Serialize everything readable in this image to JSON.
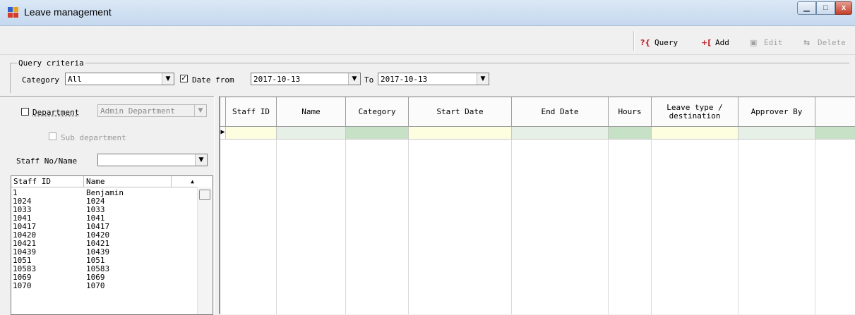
{
  "window": {
    "title": "Leave management",
    "min": "▁",
    "max": "□",
    "close": "x"
  },
  "toolbar": {
    "query": {
      "icon": "?{",
      "label": "Query"
    },
    "add": {
      "icon": "+[",
      "label": "Add"
    },
    "edit": {
      "icon": "▣",
      "label": "Edit"
    },
    "delete": {
      "icon": "⇆",
      "label": "Delete"
    }
  },
  "query": {
    "group_title": "Query criteria",
    "category_label": "Category",
    "category_value": "All",
    "date_from_label": "Date from",
    "date_from_checked": "✓",
    "date_from_value": "2017-10-13",
    "to_label": "To",
    "to_value": "2017-10-13"
  },
  "left": {
    "department_label": "Department",
    "department_value": "Admin Department",
    "sub_department_label": "Sub department",
    "staff_label": "Staff No/Name",
    "staff_value": "",
    "list_headers": [
      "Staff ID",
      "Name"
    ],
    "list_rows": [
      [
        "1",
        "Benjamin"
      ],
      [
        "1024",
        "1024"
      ],
      [
        "1033",
        "1033"
      ],
      [
        "1041",
        "1041"
      ],
      [
        "10417",
        "10417"
      ],
      [
        "10420",
        "10420"
      ],
      [
        "10421",
        "10421"
      ],
      [
        "10439",
        "10439"
      ],
      [
        "1051",
        "1051"
      ],
      [
        "10583",
        "10583"
      ],
      [
        "1069",
        "1069"
      ],
      [
        "1070",
        "1070"
      ]
    ]
  },
  "grid": {
    "columns": [
      "Staff ID",
      "Name",
      "Category",
      "Start Date",
      "End Date",
      "Hours",
      "Leave type / destination",
      "Approver By"
    ],
    "row_indicator": "▶"
  },
  "colors": {
    "row_yellow": "#fdfde0",
    "row_green": "#c7e1c7",
    "row_light": "#e6f0e6"
  }
}
